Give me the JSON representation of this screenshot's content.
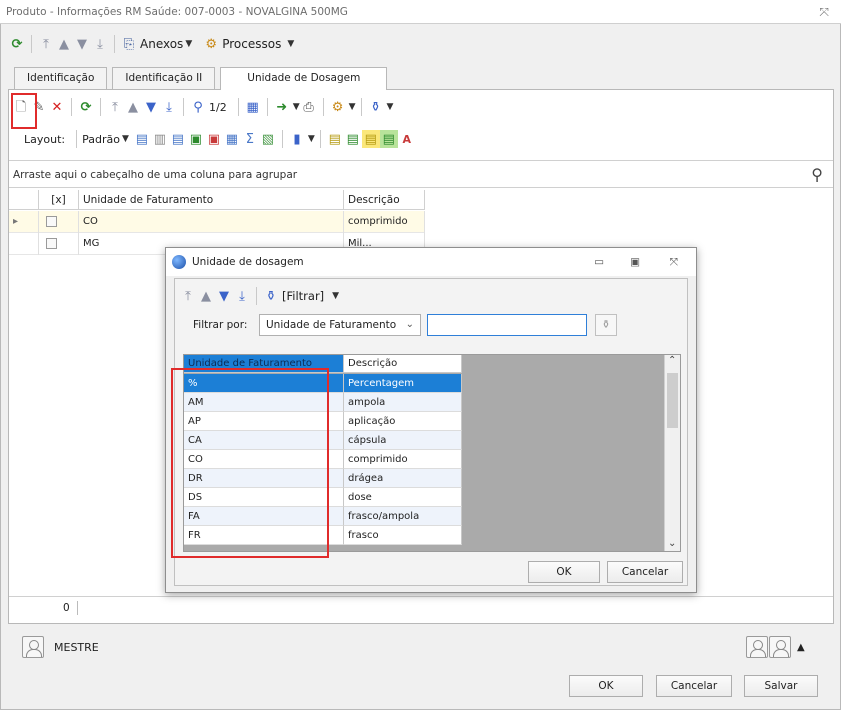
{
  "window": {
    "title": "Produto - Informações RM Saúde: 007-0003 - NOVALGINA 500MG",
    "close_glyph": "⤧"
  },
  "main_toolbar": {
    "anexos": "Anexos",
    "processos": "Processos"
  },
  "tabs": [
    {
      "label": "Identificação"
    },
    {
      "label": "Identificação II"
    },
    {
      "label": "Unidade de Dosagem"
    }
  ],
  "grid_toolbar": {
    "record_nav": "1/2"
  },
  "layout_bar": {
    "layout_label": "Layout:",
    "padrao_label": "Padrão"
  },
  "group_hint": "Arraste aqui o cabeçalho de uma coluna para agrupar",
  "grid": {
    "columns": [
      "[x]",
      "Unidade de Faturamento",
      "Descrição"
    ],
    "rows": [
      {
        "unit": "CO",
        "desc": "comprimido"
      },
      {
        "unit": "MG",
        "desc": "Mil..."
      }
    ],
    "footer_count": "0"
  },
  "user": {
    "name": "MESTRE"
  },
  "footer_buttons": {
    "ok": "OK",
    "cancel": "Cancelar",
    "save": "Salvar"
  },
  "dialog": {
    "title": "Unidade de dosagem",
    "filter_button": "[Filtrar]",
    "filter_by_label": "Filtrar por:",
    "filter_field": "Unidade de Faturamento",
    "search_value": "",
    "columns": [
      "Unidade de Faturamento",
      "Descrição"
    ],
    "rows": [
      {
        "code": "%",
        "desc": "Percentagem"
      },
      {
        "code": "AM",
        "desc": "ampola"
      },
      {
        "code": "AP",
        "desc": "aplicação"
      },
      {
        "code": "CA",
        "desc": "cápsula"
      },
      {
        "code": "CO",
        "desc": "comprimido"
      },
      {
        "code": "DR",
        "desc": "drágea"
      },
      {
        "code": "DS",
        "desc": "dose"
      },
      {
        "code": "FA",
        "desc": "frasco/ampola"
      },
      {
        "code": "FR",
        "desc": "frasco"
      }
    ],
    "ok": "OK",
    "cancel": "Cancelar"
  }
}
